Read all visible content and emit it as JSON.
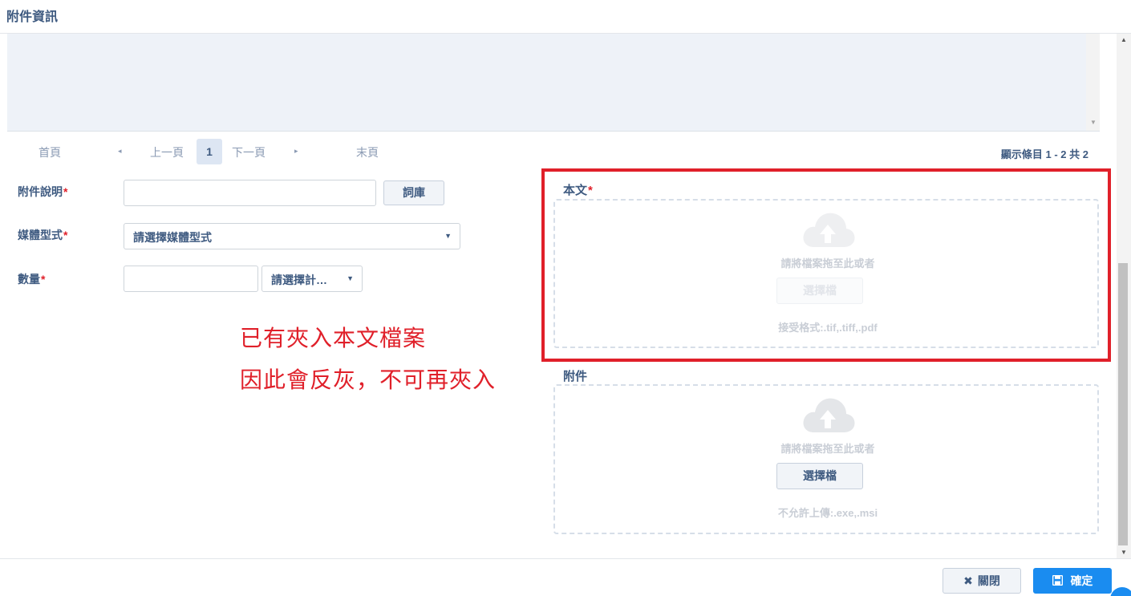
{
  "header": {
    "title": "附件資訊"
  },
  "pager": {
    "first": "首頁",
    "prev_arrow": "◂",
    "prev": "上一頁",
    "current": "1",
    "next": "下一頁",
    "next_arrow": "▸",
    "last": "末頁",
    "info": "顯示條目 1 - 2 共 2"
  },
  "form": {
    "description_label": "附件說明",
    "description_value": "",
    "thesaurus_button": "詞庫",
    "media_label": "媒體型式",
    "media_value": "請選擇媒體型式",
    "quantity_label": "數量",
    "quantity_value": "",
    "unit_value": "請選擇計…",
    "required_mark": "*"
  },
  "annotation": {
    "line1": "已有夾入本文檔案",
    "line2": "因此會反灰，不可再夾入",
    "color": "#e0202a"
  },
  "main_text": {
    "label": "本文",
    "drop_text": "請將檔案拖至此或者",
    "button": "選擇檔",
    "formats": "接受格式:.tif,.tiff,.pdf",
    "state": "disabled"
  },
  "attachment": {
    "label": "附件",
    "drop_text": "請將檔案拖至此或者",
    "button": "選擇檔",
    "formats": "不允許上傳:.exe,.msi",
    "state": "enabled"
  },
  "footer": {
    "close_icon": "close-x-icon",
    "close_label": "關閉",
    "ok_icon": "save-disk-icon",
    "ok_label": "確定"
  },
  "colors": {
    "accent": "#1a8cf0",
    "label": "#3e5a80",
    "highlight": "#e0202a",
    "placeholder": "#c9ced6"
  }
}
